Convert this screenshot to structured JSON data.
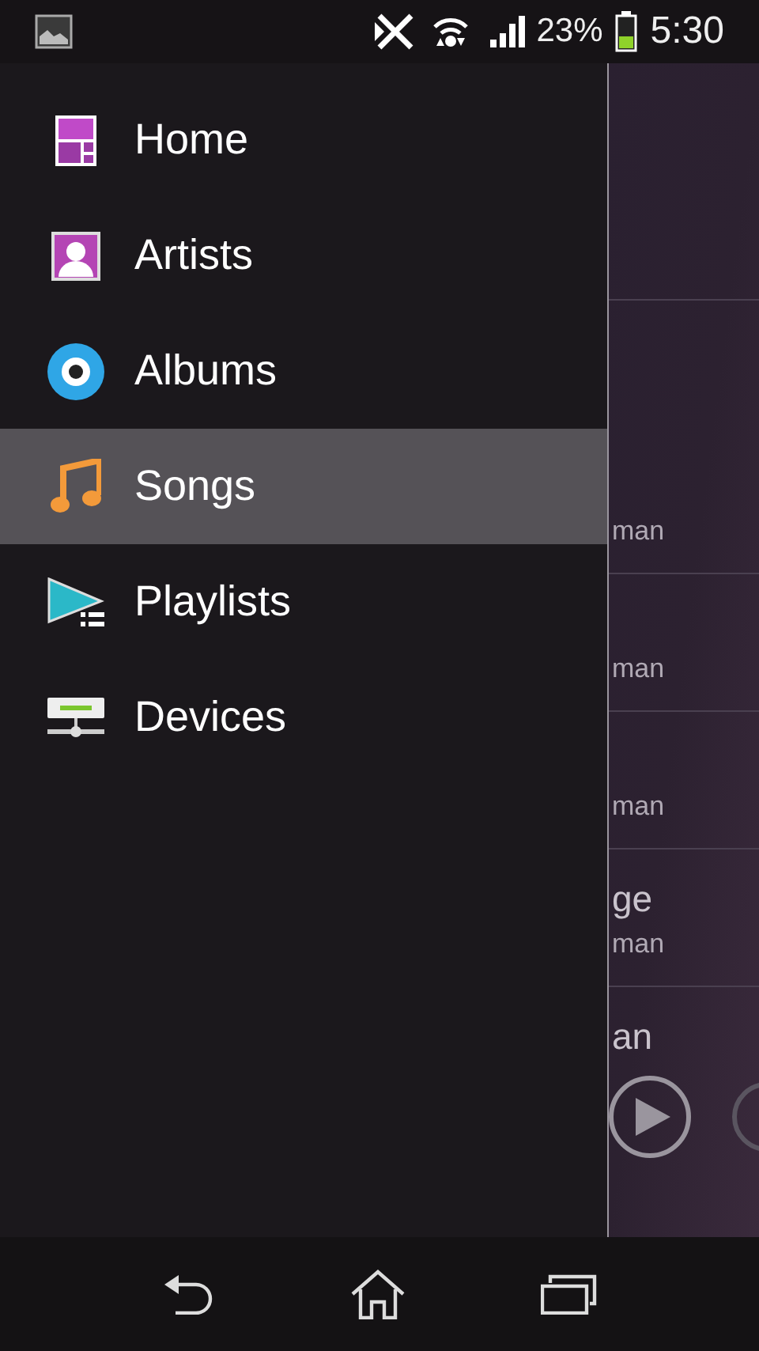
{
  "status_bar": {
    "battery": "23%",
    "time": "5:30"
  },
  "songs": [
    {
      "artist": "man"
    },
    {
      "artist": "man"
    },
    {
      "artist": "man"
    },
    {
      "title": "ge",
      "artist": "man"
    },
    {
      "title": "an"
    }
  ],
  "now_playing": {
    "playing": false
  },
  "drawer": {
    "items": [
      {
        "label": "Home",
        "kind": "home",
        "selected": false
      },
      {
        "label": "Artists",
        "kind": "artists",
        "selected": false
      },
      {
        "label": "Albums",
        "kind": "albums",
        "selected": false
      },
      {
        "label": "Songs",
        "kind": "songs",
        "selected": true
      },
      {
        "label": "Playlists",
        "kind": "playlists",
        "selected": false
      },
      {
        "label": "Devices",
        "kind": "devices",
        "selected": false
      }
    ]
  }
}
